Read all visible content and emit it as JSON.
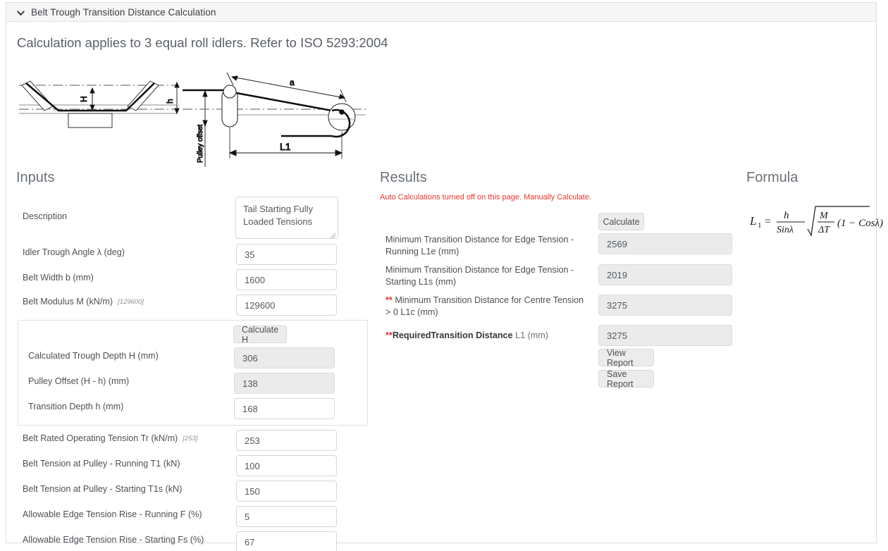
{
  "header": {
    "title": "Belt Trough Transition Distance Calculation",
    "collapse_icon": "chevron-down-icon"
  },
  "intro": "Calculation applies to 3 equal roll idlers. Refer to ISO 5293:2004",
  "diagram": {
    "labels": {
      "trough_depth": "H",
      "transition_depth": "h",
      "pulley_offset": "Pulley offset",
      "belt_run": "a",
      "transition_distance": "L1"
    }
  },
  "inputs": {
    "title": "Inputs",
    "description": {
      "label": "Description",
      "value": "Tail Starting Fully Loaded Tensions"
    },
    "fields": [
      {
        "label": "Idler Trough Angle λ (deg)",
        "hint": "",
        "value": "35",
        "readonly": false
      },
      {
        "label": "Belt Width b (mm)",
        "hint": "",
        "value": "1600",
        "readonly": false
      },
      {
        "label": "Belt Modulus M (kN/m)",
        "hint": "[129600]",
        "value": "129600",
        "readonly": false
      }
    ],
    "trough_panel": {
      "calculate_label": "Calculate H",
      "fields": [
        {
          "label": "Calculated Trough Depth H (mm)",
          "value": "306",
          "readonly": true
        },
        {
          "label": "Pulley Offset (H - h) (mm)",
          "value": "138",
          "readonly": true
        },
        {
          "label": "Transition Depth h (mm)",
          "value": "168",
          "readonly": false
        }
      ]
    },
    "fields_lower": [
      {
        "label": "Belt Rated Operating Tension Tr (kN/m)",
        "hint": "[253]",
        "value": "253",
        "readonly": false
      },
      {
        "label": "Belt Tension at Pulley - Running T1 (kN)",
        "hint": "",
        "value": "100",
        "readonly": false
      },
      {
        "label": "Belt Tension at Pulley - Starting T1s (kN)",
        "hint": "",
        "value": "150",
        "readonly": false
      },
      {
        "label": "Allowable Edge Tension Rise - Running F (%)",
        "hint": "",
        "value": "5",
        "readonly": false
      },
      {
        "label": "Allowable Edge Tension Rise - Starting Fs (%)",
        "hint": "",
        "value": "67",
        "readonly": false
      }
    ]
  },
  "results": {
    "title": "Results",
    "notice": "Auto Calculations turned off on this page. Manually Calculate.",
    "calculate_label": "Calculate",
    "rows": [
      {
        "label": "Minimum Transition Distance for Edge Tension - Running L1e (mm)",
        "value": "2569"
      },
      {
        "label": "Minimum Transition Distance for Edge Tension - Starting L1s (mm)",
        "value": "2019"
      },
      {
        "label": "Minimum Transition Distance for Centre Tension > 0 L1c (mm)",
        "value": "3275",
        "prefix_star": "**"
      },
      {
        "label": "RequiredTransition Distance",
        "label_tail": " L1 (mm)",
        "value": "3275",
        "prefix_star": "**",
        "emphasis": true
      }
    ],
    "view_report_label": "View Report",
    "save_report_label": "Save Report"
  },
  "formula": {
    "title": "Formula",
    "expression": "L1 = h / Sinλ · sqrt( M / ΔT (1 - Cosλ) )",
    "parts": {
      "lhs": "L",
      "lhs_sub": "1",
      "equals": "=",
      "numerator": "h",
      "denominator": "Sinλ",
      "radicand_num": "M",
      "radicand_den": "ΔT",
      "factor": "(1 − Cosλ)"
    }
  },
  "colors": {
    "accent_red": "#e8332a",
    "text": "#4c5156",
    "heading": "#6a7076",
    "field_border": "#d6d6d6",
    "readonly_bg": "#ebebeb",
    "button_bg": "#ececec",
    "header_bg": "#f6f6f6"
  }
}
